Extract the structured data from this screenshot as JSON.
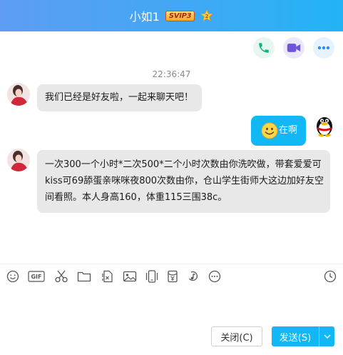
{
  "header": {
    "contact_name": "小如1",
    "vip_badge": "SVIP3",
    "colors": {
      "title_bar": "#3ea9f5",
      "accent": "#12b7f5"
    }
  },
  "actions": {
    "phone_icon": "phone-icon",
    "video_icon": "video-camera-icon",
    "more_icon": "more-dots-icon"
  },
  "chat": {
    "timestamp": "22:36:47",
    "messages": [
      {
        "sender": "peer",
        "text": "我们已经是好友啦，一起来聊天吧！"
      },
      {
        "sender": "me",
        "emoji": "smile-emoji",
        "text": "在啊"
      },
      {
        "sender": "peer",
        "lines": [
          "一次300一个小时*二次500*二个小时次数由你洗吹做，带套爱爱可",
          "kiss可69舔蛋亲咪咪夜800次数由你，仓山学生街师大这边加好友空",
          "间看照。本人身高160，体重115三围38c。"
        ]
      }
    ]
  },
  "toolbar": {
    "icons": [
      "emoji-icon",
      "gif-icon",
      "scissors-icon",
      "folder-icon",
      "doc-icon",
      "image-icon",
      "phone-screen-icon",
      "red-packet-icon",
      "music-icon",
      "more-icon",
      "history-clock-icon"
    ],
    "gif_label": "GIF"
  },
  "footer": {
    "close_label": "关闭(C)",
    "send_label": "发送(S)"
  }
}
